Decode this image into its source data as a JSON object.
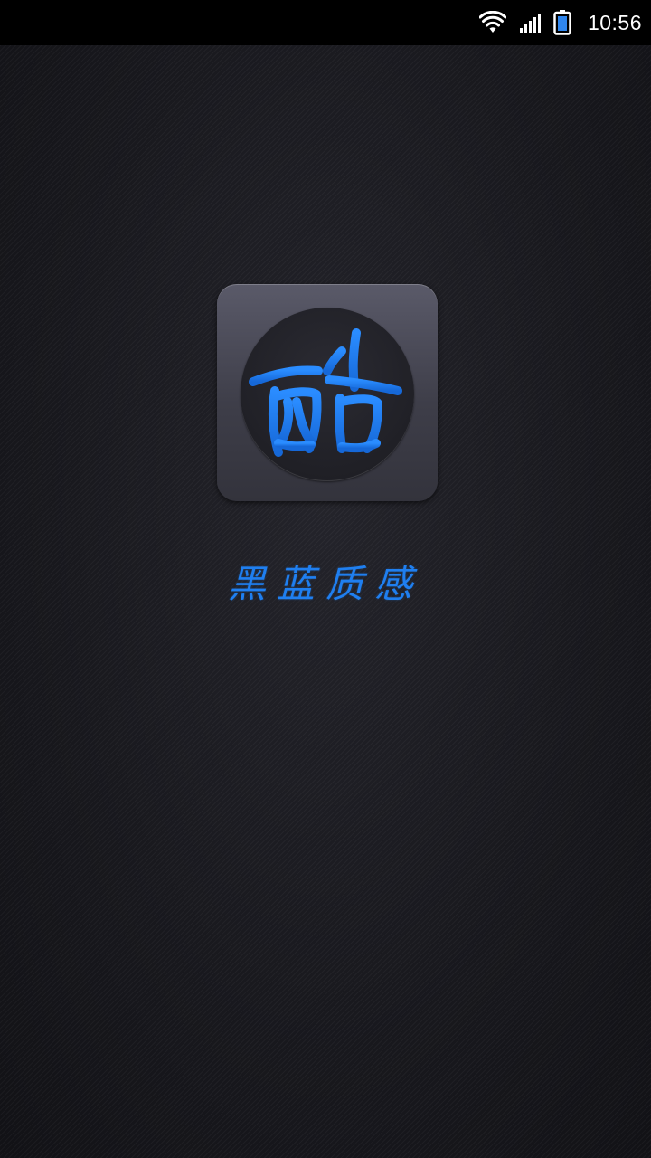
{
  "status_bar": {
    "time": "10:56",
    "icons": [
      "wifi-icon",
      "signal-icon",
      "battery-icon"
    ]
  },
  "splash": {
    "app_icon_glyph": "酷",
    "tagline": "黑蓝质感"
  },
  "colors": {
    "accent": "#1f7ff0",
    "background": "#18181d",
    "status_bar": "#000000"
  }
}
